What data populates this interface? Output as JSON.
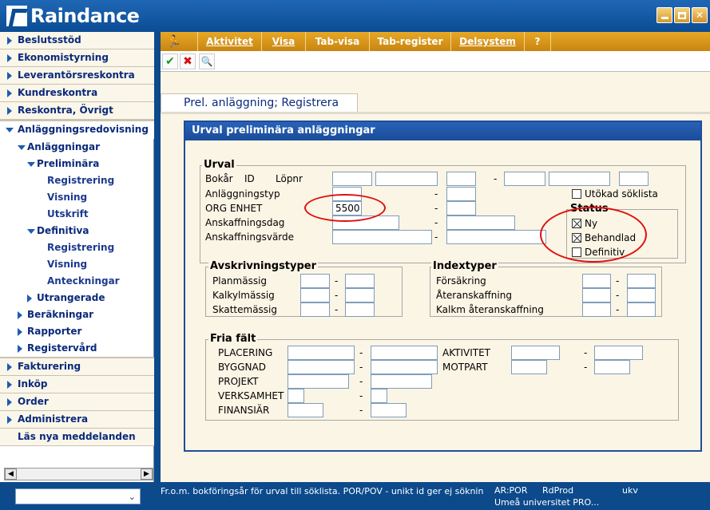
{
  "app": {
    "title": "Raindance"
  },
  "nav": {
    "top": [
      "Beslutsstöd",
      "Ekonomistyrning",
      "Leverantörsreskontra",
      "Kundreskontra",
      "Reskontra, Övrigt"
    ],
    "open_section": "Anläggningsredovisning",
    "sub": {
      "anlaggningar": "Anläggningar",
      "preliminara": "Preliminära",
      "registrering": "Registrering",
      "visning": "Visning",
      "utskrift": "Utskrift",
      "definitiva": "Definitiva",
      "def_registrering": "Registrering",
      "def_visning": "Visning",
      "anteckningar": "Anteckningar",
      "utrangerade": "Utrangerade",
      "berakningar": "Beräkningar",
      "rapporter": "Rapporter",
      "registervard": "Registervård"
    },
    "bottom": [
      "Fakturering",
      "Inköp",
      "Order",
      "Administrera"
    ],
    "messages": "Läs nya meddelanden"
  },
  "menu": [
    "Aktivitet",
    "Visa",
    "Tab-visa",
    "Tab-register",
    "Delsystem",
    "?"
  ],
  "page": {
    "tab_title": "Prel. anläggning; Registrera",
    "panel_title": "Urval preliminära anläggningar"
  },
  "urval": {
    "legend": "Urval",
    "bokar": "Bokår",
    "id": "ID",
    "lopnr": "Löpnr",
    "anlaggningstyp": "Anläggningstyp",
    "org_enhet": "ORG ENHET",
    "org_enhet_value": "5500",
    "anskaffningsdag": "Anskaffningsdag",
    "anskaffningsvarde": "Anskaffningsvärde",
    "utokad": "Utökad söklista",
    "dash": "-"
  },
  "status": {
    "legend": "Status",
    "ny": "Ny",
    "behandlad": "Behandlad",
    "definitiv": "Definitiv"
  },
  "avskrivning": {
    "legend": "Avskrivningstyper",
    "plan": "Planmässig",
    "kalkyl": "Kalkylmässig",
    "skatte": "Skattemässig"
  },
  "index": {
    "legend": "Indextyper",
    "forsakring": "Försäkring",
    "ateranskaffning": "Återanskaffning",
    "kalkm": "Kalkm återanskaffning"
  },
  "fria": {
    "legend": "Fria fält",
    "placering": "PLACERING",
    "byggnad": "BYGGNAD",
    "projekt": "PROJEKT",
    "verksamhet": "VERKSAMHET",
    "finansiar": "FINANSIÄR",
    "aktivitet": "AKTIVITET",
    "motpart": "MOTPART"
  },
  "statusbar": {
    "hint": "Fr.o.m. bokföringsår för urval till söklista. POR/POV - unikt id ger ej söknin",
    "ar": "AR:POR",
    "env": "RdProd",
    "user": "ukv",
    "org": "Umeå universitet PRO..."
  }
}
